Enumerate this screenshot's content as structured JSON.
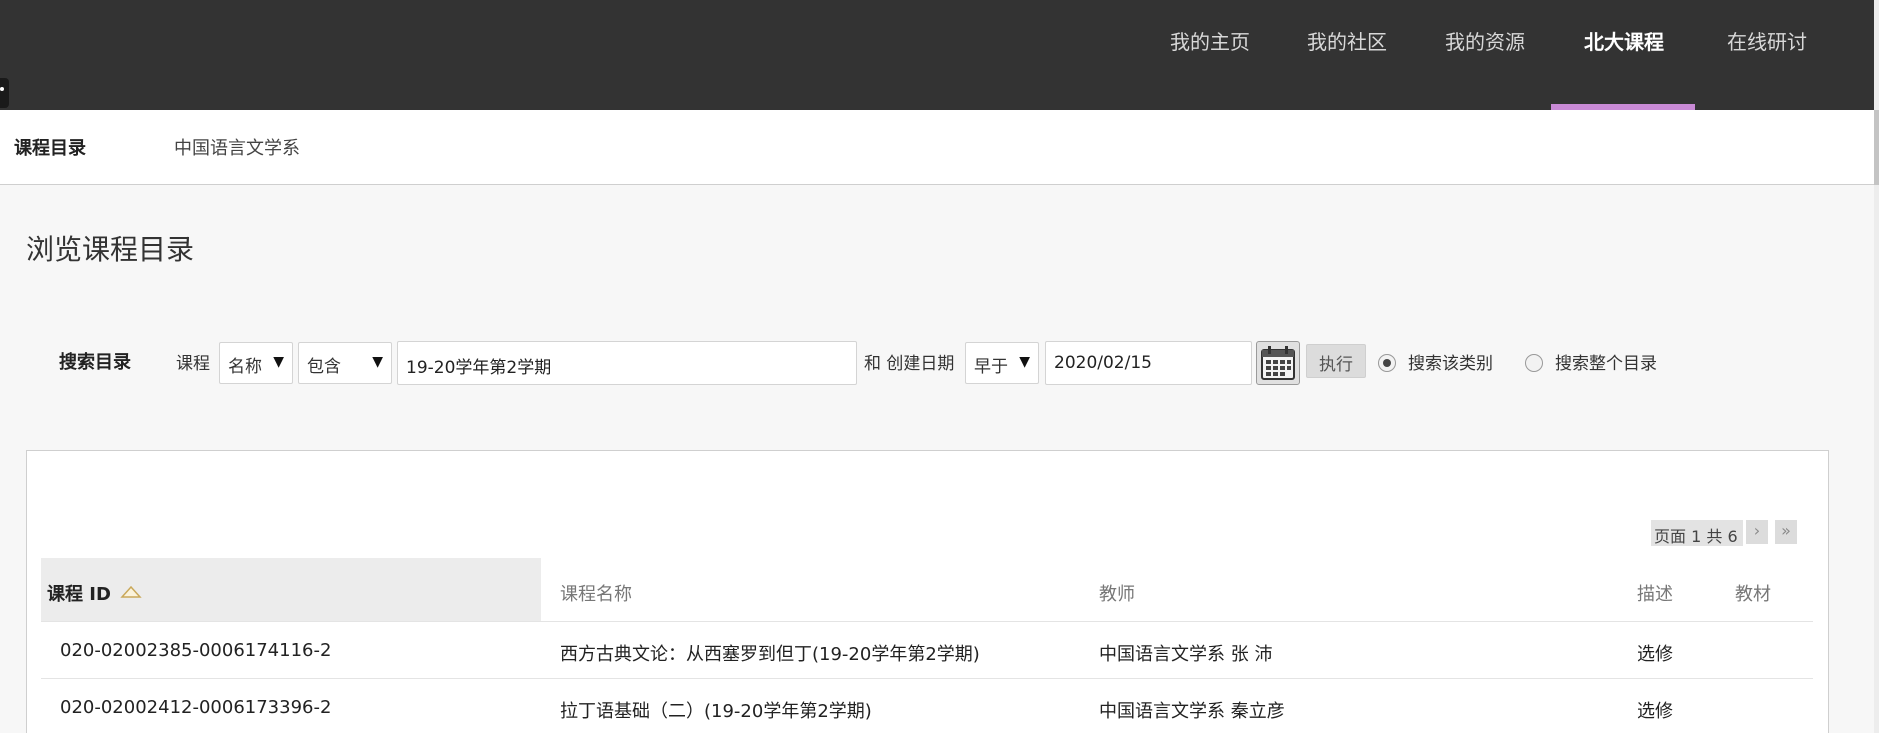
{
  "nav": {
    "items": [
      {
        "label": "我的主页",
        "active": false
      },
      {
        "label": "我的社区",
        "active": false
      },
      {
        "label": "我的资源",
        "active": false
      },
      {
        "label": "北大课程",
        "active": true
      },
      {
        "label": "在线研讨",
        "active": false
      }
    ],
    "active_underline_color": "#c98ad6"
  },
  "breadcrumb": {
    "root": "课程目录",
    "child": "中国语言文学系"
  },
  "page": {
    "title": "浏览课程目录"
  },
  "search": {
    "label": "搜索目录",
    "field_label": "课程",
    "field_select": "名称",
    "operator_select": "包含",
    "query_value": "19-20学年第2学期",
    "and_label": "和 创建日期",
    "date_operator": "早于",
    "date_value": "2020/02/15",
    "calendar_icon": "calendar-icon",
    "submit_label": "执行",
    "scope_options": [
      {
        "label": "搜索该类别",
        "checked": true
      },
      {
        "label": "搜索整个目录",
        "checked": false
      }
    ]
  },
  "pager": {
    "text": "页面 1 共 6",
    "next_icon": "chevron-right-icon",
    "last_icon": "double-chevron-right-icon"
  },
  "table": {
    "columns": [
      "课程 ID",
      "课程名称",
      "教师",
      "描述",
      "教材"
    ],
    "sort_icon": "sort-ascending-icon",
    "rows": [
      {
        "id": "020-02002385-0006174116-2",
        "name": "西方古典文论：从西塞罗到但丁(19-20学年第2学期)",
        "teacher": "中国语言文学系 张 沛",
        "desc": "选修",
        "textbook": ""
      },
      {
        "id": "020-02002412-0006173396-2",
        "name": "拉丁语基础（二）(19-20学年第2学期)",
        "teacher": "中国语言文学系 秦立彦",
        "desc": "选修",
        "textbook": ""
      }
    ]
  }
}
